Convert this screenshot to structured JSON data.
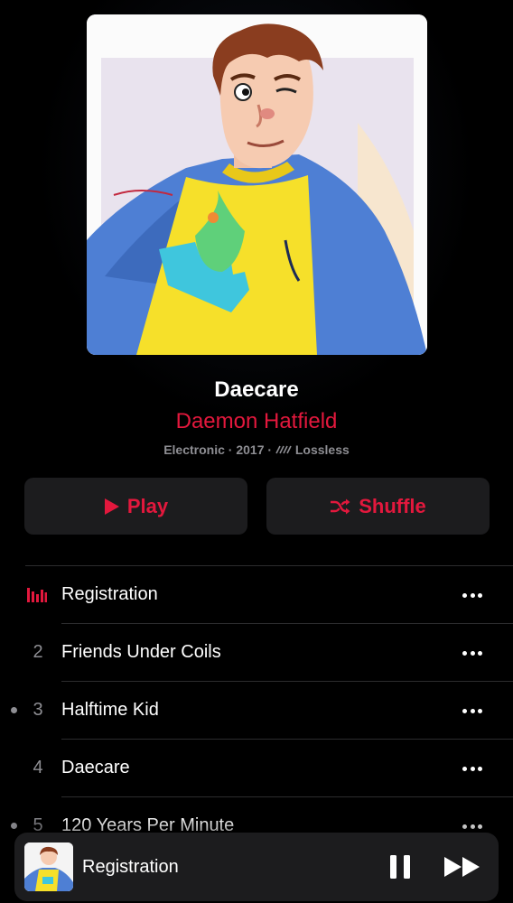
{
  "album": {
    "title": "Daecare",
    "artist": "Daemon Hatfield",
    "genre": "Electronic",
    "year": "2017",
    "quality": "Lossless",
    "meta_separator": "·"
  },
  "actions": {
    "play_label": "Play",
    "shuffle_label": "Shuffle"
  },
  "tracks": [
    {
      "number": "",
      "title": "Registration",
      "playing": true,
      "downloaded": false
    },
    {
      "number": "2",
      "title": "Friends Under Coils",
      "playing": false,
      "downloaded": false
    },
    {
      "number": "3",
      "title": "Halftime Kid",
      "playing": false,
      "downloaded": true
    },
    {
      "number": "4",
      "title": "Daecare",
      "playing": false,
      "downloaded": false
    },
    {
      "number": "5",
      "title": "120 Years Per Minute",
      "playing": false,
      "downloaded": true
    }
  ],
  "now_playing": {
    "title": "Registration",
    "state": "playing"
  },
  "colors": {
    "accent": "#e3183d",
    "background": "#000000",
    "surface": "#1c1c1e",
    "secondary_text": "#8e8e93",
    "separator": "#2c2c2e"
  },
  "icons": {
    "play": "play-icon",
    "shuffle": "shuffle-icon",
    "more": "ellipsis-icon",
    "now_playing": "equalizer-bars-icon",
    "lossless": "lossless-wave-icon",
    "pause": "pause-icon",
    "forward": "fast-forward-icon"
  }
}
